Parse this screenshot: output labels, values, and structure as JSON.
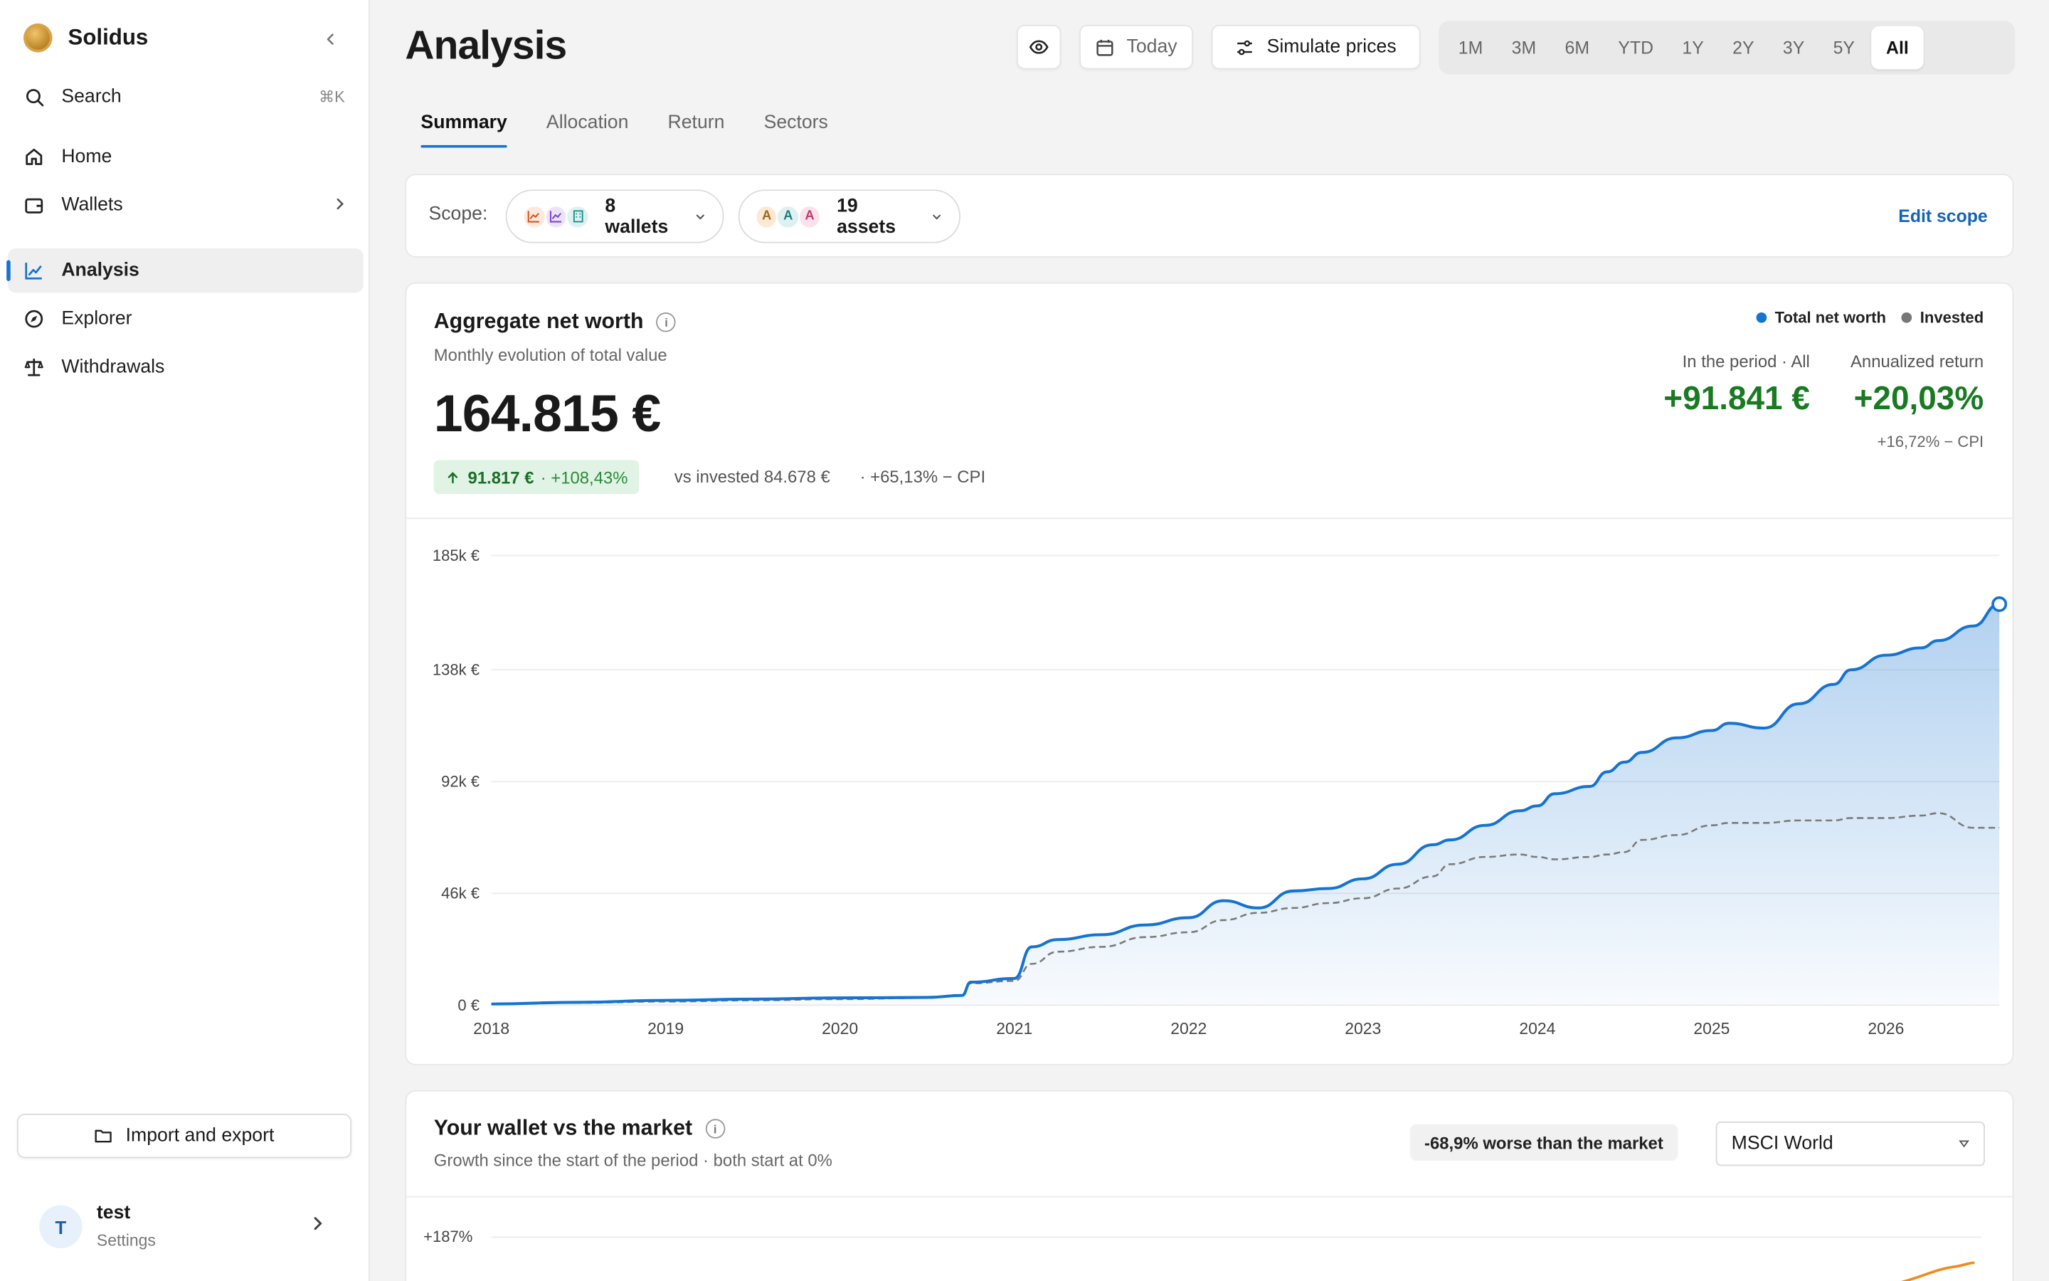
{
  "app": {
    "name": "Solidus"
  },
  "sidebar": {
    "search": {
      "label": "Search",
      "shortcut": "⌘K"
    },
    "items": [
      {
        "label": "Home",
        "icon": "home-icon"
      },
      {
        "label": "Wallets",
        "icon": "wallet-icon"
      },
      {
        "label": "Analysis",
        "icon": "chart-line-icon",
        "active": true
      },
      {
        "label": "Explorer",
        "icon": "compass-icon"
      },
      {
        "label": "Withdrawals",
        "icon": "scale-icon"
      }
    ],
    "import_export": "Import and export",
    "user": {
      "initial": "T",
      "name": "test",
      "sub": "Settings"
    }
  },
  "header": {
    "title": "Analysis",
    "today": "Today",
    "simulate": "Simulate prices",
    "ranges": [
      "1M",
      "3M",
      "6M",
      "YTD",
      "1Y",
      "2Y",
      "3Y",
      "5Y",
      "All"
    ],
    "active_range": "All"
  },
  "tabs": [
    "Summary",
    "Allocation",
    "Return",
    "Sectors"
  ],
  "scope": {
    "label": "Scope:",
    "wallets": "8 wallets",
    "assets": "19 assets",
    "asset_initials": [
      "A",
      "A",
      "A"
    ],
    "edit": "Edit scope"
  },
  "networth": {
    "title": "Aggregate net worth",
    "info": "i",
    "subtitle": "Monthly evolution of total value",
    "value": "164.815 €",
    "gain_abs": "91.817 €",
    "gain_pct": "· +108,43%",
    "vs_invested": "vs invested 84.678 €",
    "cpi": "· +65,13% − CPI",
    "legend": {
      "total": "Total net worth",
      "invested": "Invested"
    },
    "period_label": "In the period · All",
    "period_value": "+91.841 €",
    "annual_label": "Annualized return",
    "annual_value": "+20,03%",
    "annual_foot": "+16,72% − CPI",
    "colors": {
      "total": "#1573d1",
      "invested": "#7a7a7a",
      "gain": "#187a21"
    }
  },
  "chart_data": {
    "type": "area",
    "x_label": "",
    "y_label": "",
    "y_ticks": [
      "185k €",
      "138k €",
      "92k €",
      "46k €",
      "0 €"
    ],
    "y_tick_values": [
      185000,
      138000,
      92000,
      46000,
      0
    ],
    "ylim": [
      0,
      185000
    ],
    "x_ticks": [
      "2018",
      "2019",
      "2020",
      "2021",
      "2022",
      "2023",
      "2024",
      "2025",
      "2026"
    ],
    "x_tick_years": [
      2018,
      2019,
      2020,
      2021,
      2022,
      2023,
      2024,
      2025,
      2026
    ],
    "xlim": [
      2018.0,
      2026.65
    ],
    "grid": true,
    "legend": "top-right",
    "series": [
      {
        "name": "Total net worth",
        "style": "solid-area",
        "x": [
          2018.0,
          2018.5,
          2019.0,
          2019.5,
          2020.0,
          2020.5,
          2020.7,
          2020.75,
          2021.0,
          2021.1,
          2021.25,
          2021.5,
          2021.75,
          2022.0,
          2022.2,
          2022.4,
          2022.6,
          2022.8,
          2023.0,
          2023.2,
          2023.4,
          2023.5,
          2023.7,
          2023.9,
          2024.0,
          2024.1,
          2024.3,
          2024.4,
          2024.5,
          2024.6,
          2024.8,
          2025.0,
          2025.1,
          2025.3,
          2025.5,
          2025.7,
          2025.8,
          2026.0,
          2026.2,
          2026.3,
          2026.5,
          2026.65
        ],
        "y": [
          500,
          1200,
          2000,
          2500,
          3000,
          3200,
          4000,
          9500,
          11000,
          24000,
          27000,
          29000,
          33000,
          36000,
          43000,
          40000,
          47000,
          48000,
          52000,
          58000,
          66000,
          68000,
          74000,
          80000,
          82000,
          87000,
          90000,
          96000,
          100000,
          104000,
          110000,
          113000,
          116000,
          114000,
          124000,
          132000,
          138000,
          144000,
          147000,
          150000,
          156000,
          165000
        ]
      },
      {
        "name": "Invested",
        "style": "dashed",
        "x": [
          2018.0,
          2018.5,
          2019.0,
          2019.5,
          2020.0,
          2020.5,
          2020.7,
          2020.75,
          2021.0,
          2021.1,
          2021.25,
          2021.5,
          2021.75,
          2022.0,
          2022.2,
          2022.4,
          2022.6,
          2022.8,
          2023.0,
          2023.2,
          2023.4,
          2023.5,
          2023.7,
          2023.9,
          2024.0,
          2024.1,
          2024.3,
          2024.4,
          2024.5,
          2024.6,
          2024.8,
          2025.0,
          2025.1,
          2025.3,
          2025.5,
          2025.7,
          2025.8,
          2026.0,
          2026.2,
          2026.3,
          2026.5,
          2026.65
        ],
        "y": [
          500,
          1000,
          1500,
          2000,
          2500,
          3000,
          4000,
          9000,
          10000,
          17000,
          22000,
          24000,
          28000,
          30000,
          35000,
          38000,
          40000,
          42000,
          44000,
          48000,
          53000,
          58000,
          61000,
          62000,
          61000,
          60000,
          61000,
          62000,
          63000,
          68000,
          70000,
          74000,
          75000,
          75000,
          76000,
          76000,
          77000,
          77000,
          78000,
          79000,
          73000,
          73000
        ]
      }
    ]
  },
  "market": {
    "title": "Your wallet vs the market",
    "info": "i",
    "subtitle": "Growth since the start of the period · both start at 0%",
    "badge": "-68,9% worse than the market",
    "benchmark": "MSCI World",
    "first_tick": "+187%",
    "color_market": "#f08a1a"
  }
}
